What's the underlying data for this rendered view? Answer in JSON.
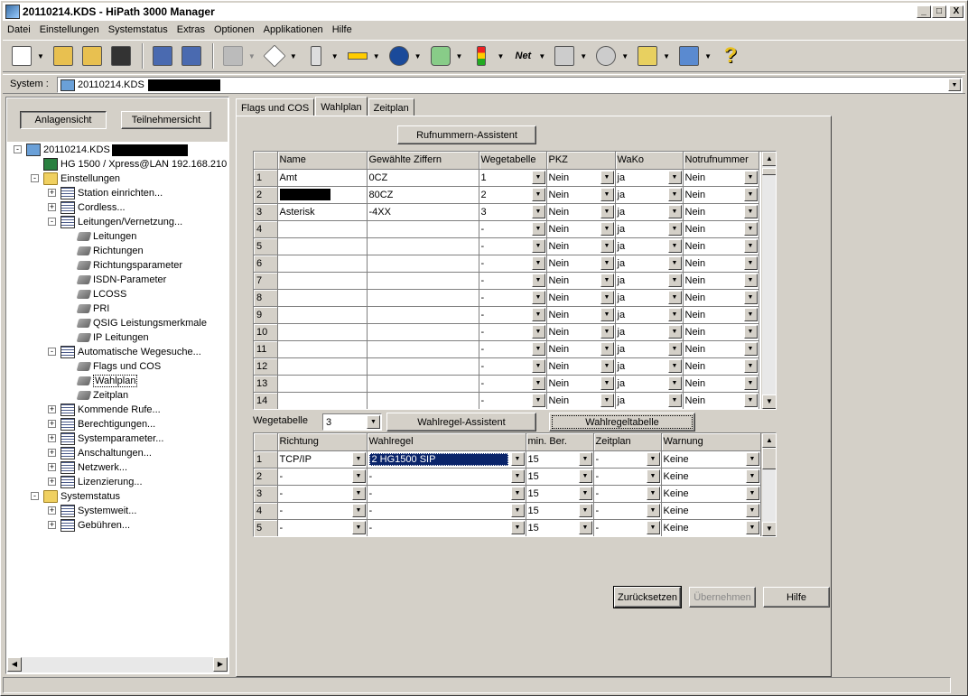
{
  "window": {
    "title": "20110214.KDS - HiPath 3000 Manager",
    "min": "_",
    "max": "□",
    "close": "X"
  },
  "menu": [
    {
      "label": "Datei"
    },
    {
      "label": "Einstellungen"
    },
    {
      "label": "Systemstatus"
    },
    {
      "label": "Extras"
    },
    {
      "label": "Optionen"
    },
    {
      "label": "Applikationen"
    },
    {
      "label": "Hilfe"
    }
  ],
  "toolbar": {
    "icons": [
      "new-icon",
      "open-icon",
      "open-folder-icon",
      "save-icon",
      "transfer-icon",
      "transfer2-icon",
      "grid-disabled-icon",
      "diamond-icon",
      "rack-icon",
      "connector-icon",
      "network-direction-icon",
      "puzzle-icon",
      "traffic-light-icon",
      "net-icon",
      "tree-config-icon",
      "phone-config-icon",
      "gears-icon",
      "monitor-config-icon",
      "help-icon"
    ],
    "net_label": "Net",
    "help_label": "?"
  },
  "system": {
    "label": "System :",
    "value": "20110214.KDS"
  },
  "left": {
    "btn_anlagen": "Anlagensicht",
    "btn_teilnehmer": "Teilnehmersicht",
    "tree": [
      {
        "label": "20110214.KDS",
        "level": 0,
        "icon": "comp",
        "exp": "-"
      },
      {
        "label": "HG 1500 / Xpress@LAN  192.168.210",
        "level": 1,
        "icon": "hg",
        "exp": ""
      },
      {
        "label": "Einstellungen",
        "level": 1,
        "icon": "folder",
        "exp": "-"
      },
      {
        "label": "Station einrichten...",
        "level": 2,
        "icon": "grid",
        "exp": "+"
      },
      {
        "label": "Cordless...",
        "level": 2,
        "icon": "grid",
        "exp": "+"
      },
      {
        "label": "Leitungen/Vernetzung...",
        "level": 2,
        "icon": "grid",
        "exp": "-"
      },
      {
        "label": "Leitungen",
        "level": 3,
        "icon": "leaf",
        "exp": ""
      },
      {
        "label": "Richtungen",
        "level": 3,
        "icon": "leaf",
        "exp": ""
      },
      {
        "label": "Richtungsparameter",
        "level": 3,
        "icon": "leaf",
        "exp": ""
      },
      {
        "label": "ISDN-Parameter",
        "level": 3,
        "icon": "leaf",
        "exp": ""
      },
      {
        "label": "LCOSS",
        "level": 3,
        "icon": "leaf",
        "exp": ""
      },
      {
        "label": "PRI",
        "level": 3,
        "icon": "leaf",
        "exp": ""
      },
      {
        "label": "QSIG Leistungsmerkmale",
        "level": 3,
        "icon": "leaf",
        "exp": ""
      },
      {
        "label": "IP Leitungen",
        "level": 3,
        "icon": "leaf",
        "exp": ""
      },
      {
        "label": "Automatische Wegesuche...",
        "level": 2,
        "icon": "grid",
        "exp": "-"
      },
      {
        "label": "Flags und COS",
        "level": 3,
        "icon": "leaf",
        "exp": ""
      },
      {
        "label": "Wahlplan",
        "level": 3,
        "icon": "leaf",
        "exp": "",
        "selected": true
      },
      {
        "label": "Zeitplan",
        "level": 3,
        "icon": "leaf",
        "exp": ""
      },
      {
        "label": "Kommende Rufe...",
        "level": 2,
        "icon": "grid",
        "exp": "+"
      },
      {
        "label": "Berechtigungen...",
        "level": 2,
        "icon": "grid",
        "exp": "+"
      },
      {
        "label": "Systemparameter...",
        "level": 2,
        "icon": "grid",
        "exp": "+"
      },
      {
        "label": "Anschaltungen...",
        "level": 2,
        "icon": "grid",
        "exp": "+"
      },
      {
        "label": "Netzwerk...",
        "level": 2,
        "icon": "grid",
        "exp": "+"
      },
      {
        "label": "Lizenzierung...",
        "level": 2,
        "icon": "grid",
        "exp": "+"
      },
      {
        "label": "Systemstatus",
        "level": 1,
        "icon": "folder",
        "exp": "-"
      },
      {
        "label": "Systemweit...",
        "level": 2,
        "icon": "grid",
        "exp": "+"
      },
      {
        "label": "Gebühren...",
        "level": 2,
        "icon": "grid",
        "exp": "+"
      }
    ]
  },
  "tabs": [
    "Flags und COS",
    "Wahlplan",
    "Zeitplan"
  ],
  "rufnummern_btn": "Rufnummern-Assistent",
  "grid1": {
    "headers": [
      "",
      "Name",
      "Gewählte Ziffern",
      "Wegetabelle",
      "PKZ",
      "WaKo",
      "Notrufnummer"
    ],
    "rows": [
      [
        "1",
        "Amt",
        "0CZ",
        "1",
        "Nein",
        "ja",
        "Nein"
      ],
      [
        "2",
        "",
        "80CZ",
        "2",
        "Nein",
        "ja",
        "Nein"
      ],
      [
        "3",
        "Asterisk",
        "-4XX",
        "3",
        "Nein",
        "ja",
        "Nein"
      ],
      [
        "4",
        "",
        "",
        "-",
        "Nein",
        "ja",
        "Nein"
      ],
      [
        "5",
        "",
        "",
        "-",
        "Nein",
        "ja",
        "Nein"
      ],
      [
        "6",
        "",
        "",
        "-",
        "Nein",
        "ja",
        "Nein"
      ],
      [
        "7",
        "",
        "",
        "-",
        "Nein",
        "ja",
        "Nein"
      ],
      [
        "8",
        "",
        "",
        "-",
        "Nein",
        "ja",
        "Nein"
      ],
      [
        "9",
        "",
        "",
        "-",
        "Nein",
        "ja",
        "Nein"
      ],
      [
        "10",
        "",
        "",
        "-",
        "Nein",
        "ja",
        "Nein"
      ],
      [
        "11",
        "",
        "",
        "-",
        "Nein",
        "ja",
        "Nein"
      ],
      [
        "12",
        "",
        "",
        "-",
        "Nein",
        "ja",
        "Nein"
      ],
      [
        "13",
        "",
        "",
        "-",
        "Nein",
        "ja",
        "Nein"
      ],
      [
        "14",
        "",
        "",
        "-",
        "Nein",
        "ja",
        "Nein"
      ]
    ]
  },
  "wegetabelle": {
    "label": "Wegetabelle",
    "value": "3",
    "assist_btn": "Wahlregel-Assistent",
    "table_btn": "Wahlregeltabelle"
  },
  "grid2": {
    "headers": [
      "",
      "Richtung",
      "Wahlregel",
      "min. Ber.",
      "Zeitplan",
      "Warnung"
    ],
    "rows": [
      [
        "1",
        "TCP/IP",
        "2   HG1500 SIP",
        "15",
        "-",
        "Keine"
      ],
      [
        "2",
        "-",
        "-",
        "15",
        "-",
        "Keine"
      ],
      [
        "3",
        "-",
        "-",
        "15",
        "-",
        "Keine"
      ],
      [
        "4",
        "-",
        "-",
        "15",
        "-",
        "Keine"
      ],
      [
        "5",
        "-",
        "-",
        "15",
        "-",
        "Keine"
      ]
    ]
  },
  "buttons": {
    "reset": "Zurücksetzen",
    "apply": "Übernehmen",
    "help": "Hilfe"
  }
}
